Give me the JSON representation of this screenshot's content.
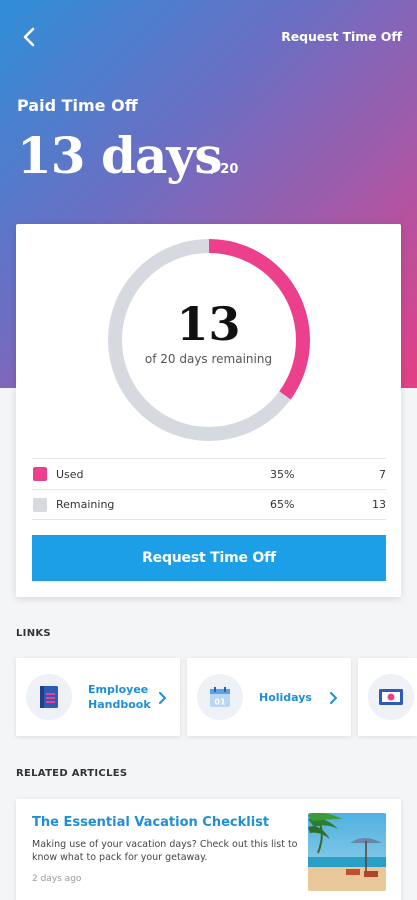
{
  "header": {
    "back_icon": "chevron-left-icon",
    "action_label": "Request Time Off",
    "title": "Paid Time Off",
    "days_value": "13 days",
    "days_total": "/ 20"
  },
  "summary": {
    "remaining_number": "13",
    "remaining_caption": "of 20 days remaining",
    "used_fraction": 0.35,
    "colors": {
      "used": "#ec3f8c",
      "remaining": "#d6d9e0",
      "accent": "#1c9fe6"
    },
    "legend": [
      {
        "label": "Used",
        "percent": "35%",
        "count": "7"
      },
      {
        "label": "Remaining",
        "percent": "65%",
        "count": "13"
      }
    ],
    "button_label": "Request Time Off"
  },
  "links": {
    "section_title": "LINKS",
    "items": [
      {
        "line1": "Employee",
        "line2": "Handbook",
        "icon": "handbook-icon"
      },
      {
        "line1": "Holidays",
        "line2": "",
        "icon": "calendar-icon"
      },
      {
        "line1": "",
        "line2": "",
        "icon": "money-icon"
      }
    ]
  },
  "articles": {
    "section_title": "RELATED ARTICLES",
    "items": [
      {
        "title": "The Essential Vacation Checklist",
        "excerpt": "Making use of your vacation days? Check out this list to know what to pack for your getaway.",
        "meta": "2 days ago",
        "image": "beach-image"
      }
    ]
  }
}
